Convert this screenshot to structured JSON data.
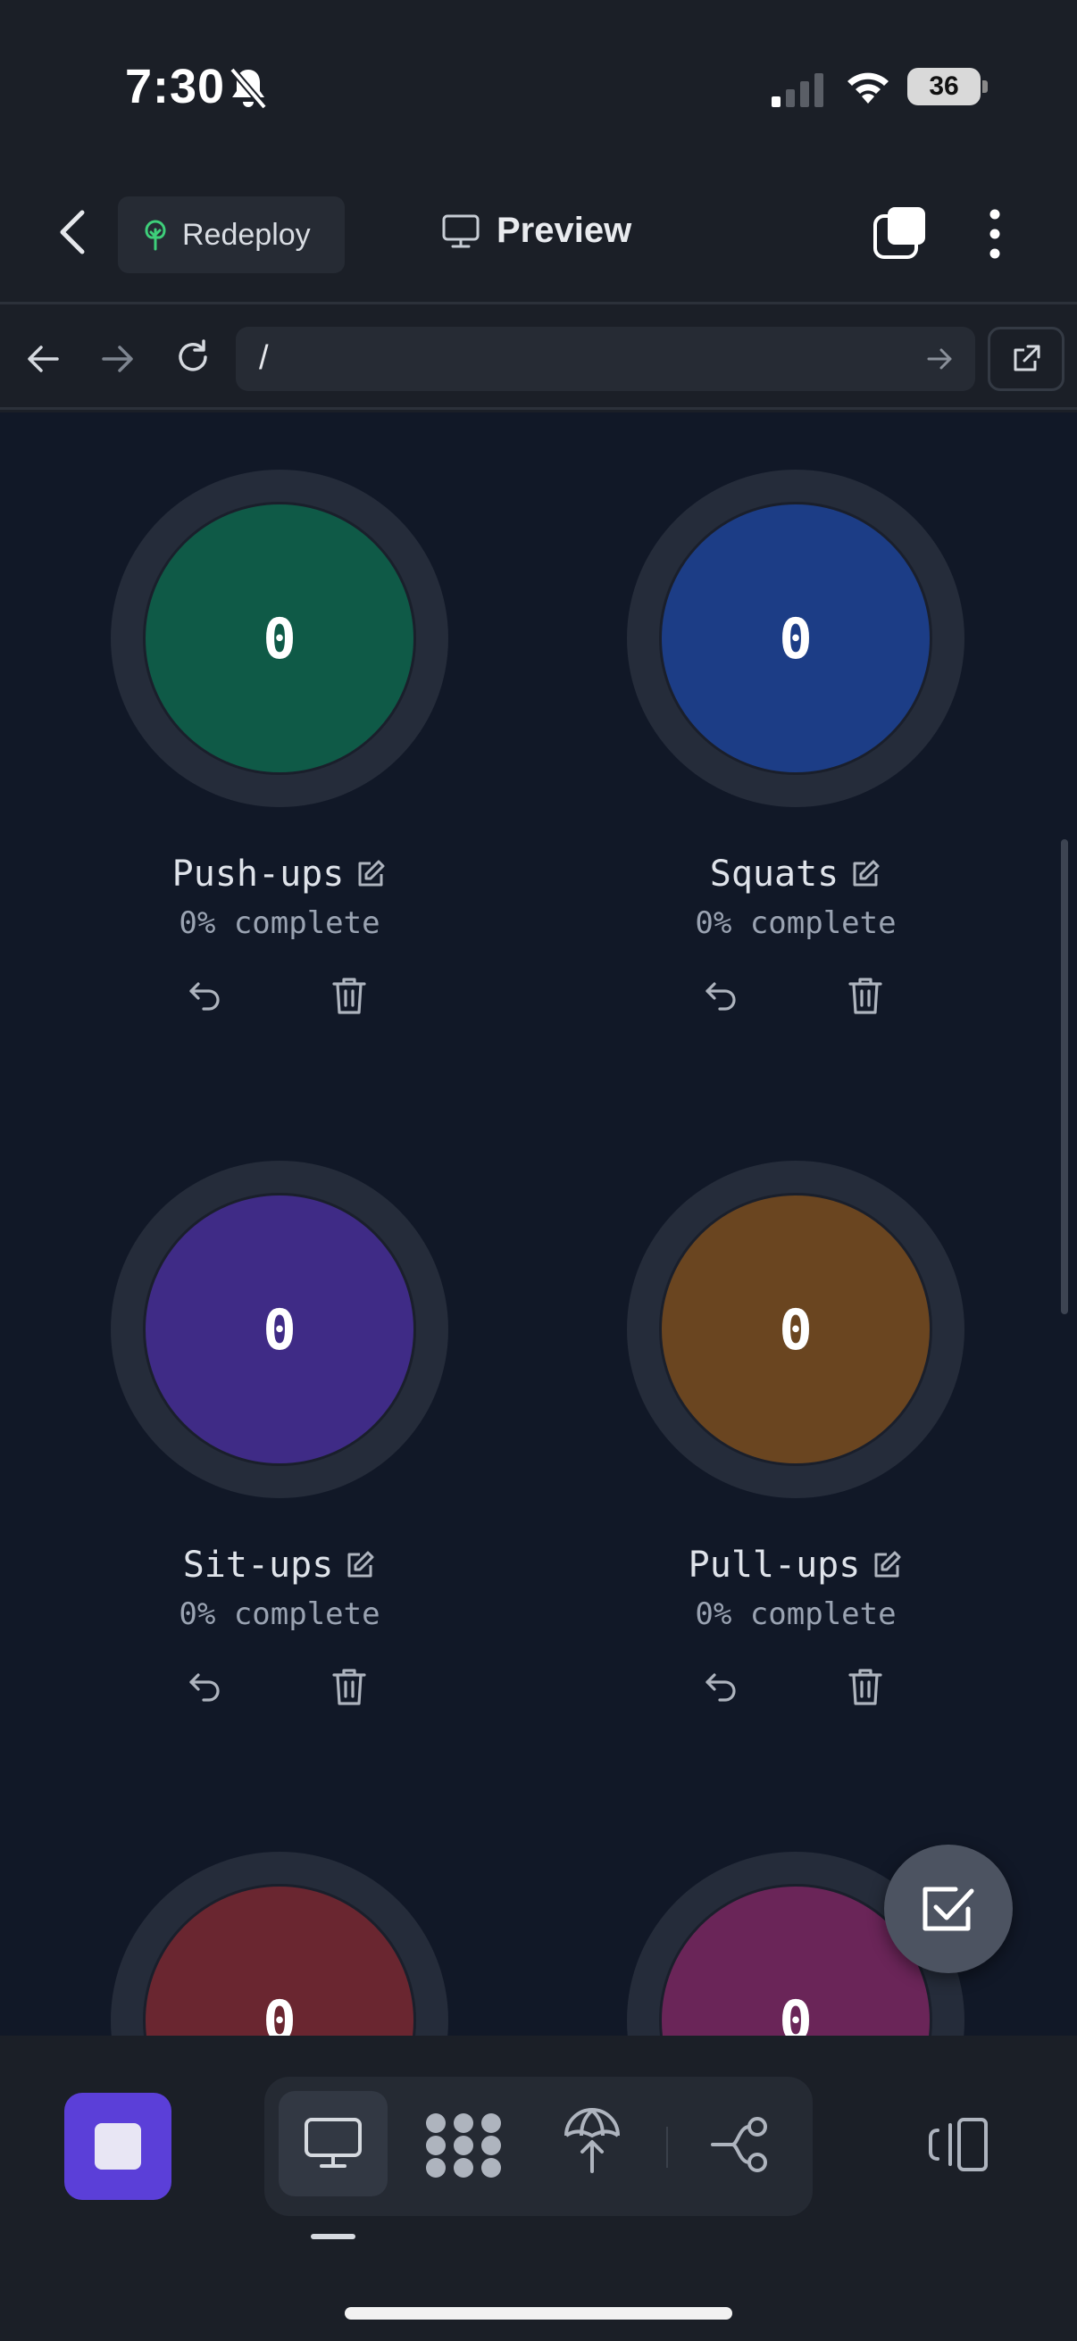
{
  "status_bar": {
    "time": "7:30",
    "battery": "36"
  },
  "header": {
    "redeploy_label": "Redeploy",
    "title": "Preview"
  },
  "browser": {
    "url": "/"
  },
  "counters": [
    {
      "name": "Push-ups",
      "count": "0",
      "progress": "0% complete",
      "color": "#0f5a47"
    },
    {
      "name": "Squats",
      "count": "0",
      "progress": "0% complete",
      "color": "#1c3d86"
    },
    {
      "name": "Sit-ups",
      "count": "0",
      "progress": "0% complete",
      "color": "#3f2b86"
    },
    {
      "name": "Pull-ups",
      "count": "0",
      "progress": "0% complete",
      "color": "#6a4520"
    },
    {
      "name": "",
      "count": "0",
      "progress": "",
      "color": "#6a2630"
    },
    {
      "name": "",
      "count": "0",
      "progress": "",
      "color": "#6a2558"
    }
  ],
  "colors": {
    "accent": "#5b3fd8",
    "content_bg": "#111827",
    "chrome_bg": "#1b1f27"
  },
  "icons": {
    "redeploy": "redeploy-tree-icon",
    "preview": "monitor-icon",
    "fab": "checkbox-icon"
  }
}
